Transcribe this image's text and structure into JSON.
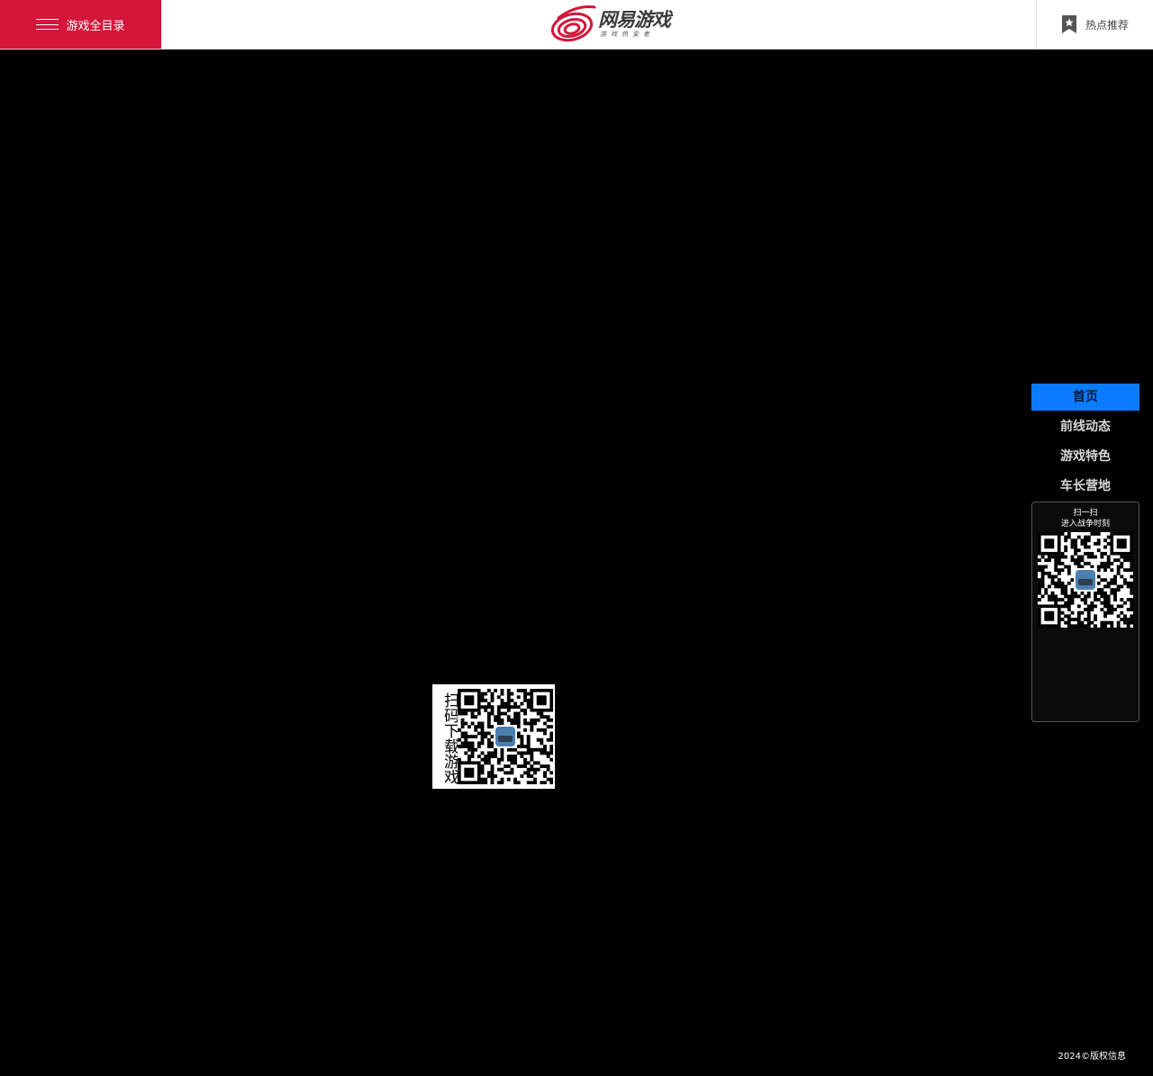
{
  "header": {
    "menu_label": "游戏全目录",
    "logo_text": "网易游戏",
    "logo_slogan": "游戏热爱者",
    "hot_label": "热点推荐",
    "brand_color": "#d3163a"
  },
  "sidenav": {
    "items": [
      {
        "label": "首页",
        "active": true
      },
      {
        "label": "前线动态",
        "active": false
      },
      {
        "label": "游戏特色",
        "active": false
      },
      {
        "label": "车长营地",
        "active": false
      }
    ],
    "active_color": "#0b7bff",
    "qr_title": "扫一扫",
    "qr_subtitle": "进入战争时刻"
  },
  "download": {
    "label": "扫码下载游戏"
  },
  "footer": {
    "copyright": "2024©版权信息"
  }
}
